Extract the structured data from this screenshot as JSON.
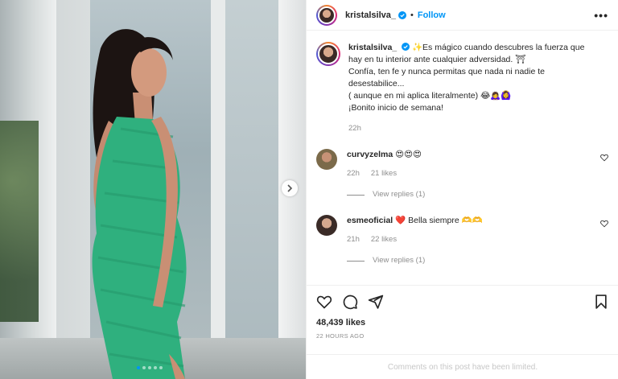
{
  "post": {
    "author": "kristalsilva_",
    "follow_label": "Follow",
    "separator": "•",
    "more_label": "•••"
  },
  "caption": {
    "username": "kristalsilva_",
    "line1": "✨Es mágico cuando descubres la fuerza que hay en tu interior ante cualquier adversidad. ⛩",
    "line2": "Confía, ten fe y nunca permitas que nada ni nadie te desestabilice...",
    "line3": "( aunque en mi aplica literalmente) 😂🙇‍♀️🙆‍♀️",
    "line4": "¡Bonito inicio de semana!",
    "time": "22h"
  },
  "comments": [
    {
      "username": "curvyzelma",
      "text": "😍😍😍",
      "time": "22h",
      "likes": "21 likes",
      "replies": "View replies (1)"
    },
    {
      "username": "esmeoficial",
      "text": "❤️ Bella siempre 🫶🫶",
      "time": "21h",
      "likes": "22 likes",
      "replies": "View replies (1)"
    }
  ],
  "stats": {
    "likes": "48,439 likes",
    "posted": "22 HOURS AGO"
  },
  "footer": {
    "limited": "Comments on this post have been limited."
  },
  "colors": {
    "accent": "#0095f6",
    "dress": "#2fb07e",
    "muted": "#8e8e8e"
  }
}
